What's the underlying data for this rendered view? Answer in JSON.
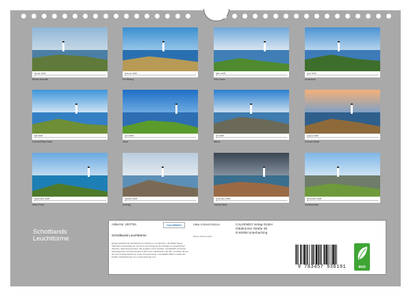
{
  "calendar_title": "Schottlands Leuchttürme",
  "title_line1": "Schottlands",
  "title_line2": "Leuchttürme",
  "months": [
    {
      "month": "Januar 2025",
      "caption": "Eilean Musdile",
      "palette": {
        "sky": "#8fb7d8",
        "sky2": "#c9d9e6",
        "sea": "#4c7fa6",
        "land": "#5f7a3a",
        "accent": "#ffffff"
      }
    },
    {
      "month": "Februar 2025",
      "caption": "Fin Blaruy",
      "palette": {
        "sky": "#3a8fd1",
        "sky2": "#9cc8ea",
        "sea": "#2a70b0",
        "land": "#b79a55",
        "accent": "#ffffff"
      }
    },
    {
      "month": "März 2025",
      "caption": "Sule Noss",
      "palette": {
        "sky": "#6fa8dc",
        "sky2": "#dfe9f2",
        "sea": "#3f7fb6",
        "land": "#4f8a2f",
        "accent": "#ffffff"
      }
    },
    {
      "month": "April 2025",
      "caption": "Ardentuor",
      "palette": {
        "sky": "#4b92d2",
        "sky2": "#bcd8ef",
        "sea": "#3c7bb8",
        "land": "#3e6e2c",
        "accent": "#ffffff"
      }
    },
    {
      "month": "Mai 2025",
      "caption": "Dunnet/Hilly Head",
      "palette": {
        "sky": "#3e95da",
        "sky2": "#d7e8f5",
        "sea": "#3480c4",
        "land": "#6e8f36",
        "accent": "#ffffff"
      }
    },
    {
      "month": "Juni 2025",
      "caption": "Stoer",
      "palette": {
        "sky": "#1f6fc7",
        "sky2": "#72aee2",
        "sea": "#2e6fb3",
        "land": "#5a9b2c",
        "accent": "#f0f0f0"
      }
    },
    {
      "month": "Juli 2025",
      "caption": "Whus",
      "palette": {
        "sky": "#2b7fd0",
        "sky2": "#d3e4f1",
        "sea": "#3f7cb0",
        "land": "#6b6a58",
        "accent": "#ffffff"
      }
    },
    {
      "month": "August 2025",
      "caption": "Dunnet Head",
      "palette": {
        "sky": "#f3b07a",
        "sky2": "#7aa0c9",
        "sea": "#2f5f8c",
        "land": "#8e6a3b",
        "accent": "#ffffff"
      }
    },
    {
      "month": "September 2025",
      "caption": "Neist Point",
      "palette": {
        "sky": "#6aa9e0",
        "sky2": "#c6def2",
        "sea": "#1e7fb5",
        "land": "#4e7a2a",
        "accent": "#ffffff"
      }
    },
    {
      "month": "Oktober 2025",
      "caption": "Ardnag",
      "palette": {
        "sky": "#b9ccdd",
        "sky2": "#e4ebf1",
        "sea": "#5d8fb6",
        "land": "#7a6a55",
        "accent": "#ffffff"
      }
    },
    {
      "month": "November 2025",
      "caption": "Turbat Ness",
      "palette": {
        "sky": "#3b4552",
        "sky2": "#8896a4",
        "sea": "#3a6f8f",
        "land": "#9a6a45",
        "accent": "#ffffff"
      }
    },
    {
      "month": "Dezember 2025",
      "caption": "Southerness",
      "palette": {
        "sky": "#7fb6e6",
        "sky2": "#d2e6f5",
        "sea": "#6f7d6a",
        "land": "#6f9a3c",
        "accent": "#ffffff"
      }
    }
  ],
  "infobox": {
    "article_label": "Artikel-Nr. 2007784",
    "brand": "CALVENDO",
    "product_title": "Schottlands Leuchttürme",
    "description": "Einige bezaubernde Schottische Leuchttürme zu entdecken, das Bildet dieses Kalenders herausstehend und ohne Genehmigung des Verlages in gewerblichen Zwecken weiterzuverwenden. Die Angaben ohne Gewähr. CALVENDO produziert bedarfsgerecht und klimaneutral in DE & EU. Papierfarbe FSC Mix. Produkte dienen als reine Funktionsleistung. Keine Transportwege. CALVENDO Bilder & Kalender. E-Mail: info@calvendo.com | www.calvendo.com",
    "isbn": "ISBN 9783457936191",
    "photographer": "Bianca Rotava-Hahn",
    "publisher_line1": "CALVENDO Verlag GmbH",
    "publisher_line2": "Ottobrunner Straße 39",
    "publisher_line3": "D-82008 Unterhaching"
  },
  "barcode_number": "9 783457 936191",
  "eco_label": "eco",
  "colors": {
    "calendar_bg": "#a9a9a9",
    "eco_green": "#3fa535"
  }
}
